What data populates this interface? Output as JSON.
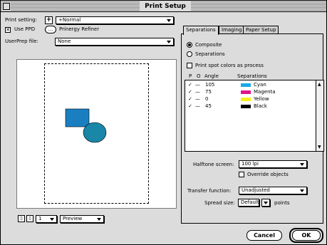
{
  "window": {
    "title": "Print Setup"
  },
  "print_setting": {
    "label": "Print setting:",
    "value": "+Normal"
  },
  "use_ppd": {
    "label": "Use PPD",
    "checked": true
  },
  "prinergy_refiner": {
    "label": "Prinergy Refiner"
  },
  "userprep": {
    "label": "UserPrep file:",
    "value": "None"
  },
  "preview_bar": {
    "page_value": "1",
    "mode_value": "Preview"
  },
  "tabs": [
    "Separations",
    "Imaging",
    "Paper Setup"
  ],
  "separations": {
    "composite_label": "Composite",
    "separations_label": "Separations",
    "spot_label": "Print spot colors as process",
    "headers": {
      "p": "P",
      "o": "O",
      "angle": "Angle",
      "seps": "Separations"
    },
    "rows": [
      {
        "check": "✓",
        "o": "—",
        "angle": "105",
        "name": "Cyan",
        "color": "#1aa9e6"
      },
      {
        "check": "✓",
        "o": "—",
        "angle": "75",
        "name": "Magenta",
        "color": "#e0148c"
      },
      {
        "check": "✓",
        "o": "—",
        "angle": "0",
        "name": "Yellow",
        "color": "#f7ef1a"
      },
      {
        "check": "✓",
        "o": "—",
        "angle": "45",
        "name": "Black",
        "color": "#000000"
      }
    ]
  },
  "halftone": {
    "label": "Halftone screen:",
    "value": "100 lpi",
    "override_label": "Override objects"
  },
  "transfer": {
    "label": "Transfer function:",
    "value": "Unadjusted"
  },
  "spread": {
    "label": "Spread size:",
    "value": "Default",
    "unit": "points"
  },
  "buttons": {
    "cancel": "Cancel",
    "ok": "OK"
  },
  "shapes": {
    "rect_color": "#1a7fc1",
    "circle_color": "#1a86a8"
  }
}
